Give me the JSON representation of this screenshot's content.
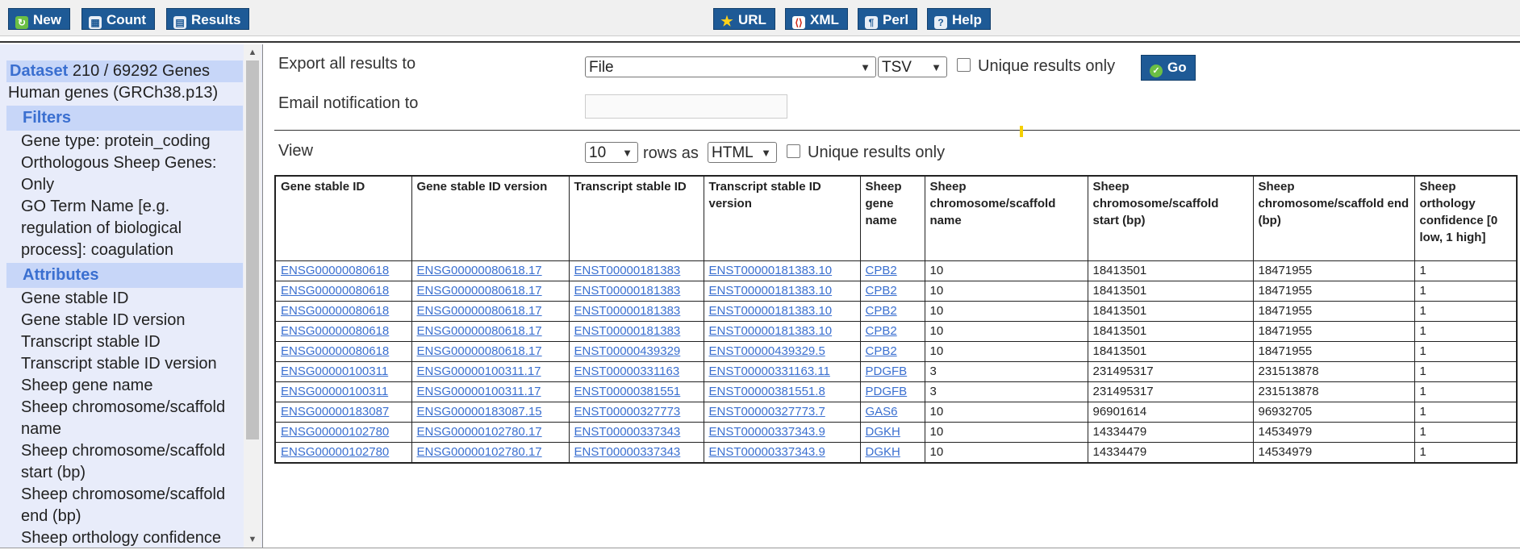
{
  "toolbar": {
    "left": [
      {
        "label": "New",
        "icon": "refresh-icon"
      },
      {
        "label": "Count",
        "icon": "calculator-icon"
      },
      {
        "label": "Results",
        "icon": "table-icon"
      }
    ],
    "right": [
      {
        "label": "URL",
        "icon": "star-icon"
      },
      {
        "label": "XML",
        "icon": "xml-icon"
      },
      {
        "label": "Perl",
        "icon": "perl-icon"
      },
      {
        "label": "Help",
        "icon": "help-icon"
      }
    ]
  },
  "sidebar": {
    "dataset_label": "Dataset",
    "dataset_count": "210 / 69292 Genes",
    "dataset_name": "Human genes (GRCh38.p13)",
    "filters_title": "Filters",
    "filters": [
      "Gene type: protein_coding",
      "Orthologous Sheep Genes: Only",
      "GO Term Name [e.g. regulation of biological process]: coagulation"
    ],
    "attributes_title": "Attributes",
    "attributes": [
      "Gene stable ID",
      "Gene stable ID version",
      "Transcript stable ID",
      "Transcript stable ID version",
      "Sheep gene name",
      "Sheep chromosome/scaffold name",
      "Sheep chromosome/scaffold start (bp)",
      "Sheep chromosome/scaffold end (bp)",
      "Sheep orthology confidence"
    ]
  },
  "export": {
    "label": "Export  all results to",
    "destination": "File",
    "format": "TSV",
    "unique_label": "Unique results only",
    "go_label": "Go"
  },
  "email": {
    "label": "Email notification to",
    "value": ""
  },
  "view": {
    "label": "View",
    "rows": "10",
    "rows_as": "rows as",
    "format": "HTML",
    "unique_label": "Unique results only"
  },
  "table": {
    "columns": [
      "Gene stable ID",
      "Gene stable ID version",
      "Transcript stable ID",
      "Transcript stable ID version",
      "Sheep gene name",
      "Sheep chromosome/scaffold name",
      "Sheep chromosome/scaffold start (bp)",
      "Sheep chromosome/scaffold end (bp)",
      "Sheep orthology confidence [0 low, 1 high]"
    ],
    "rows": [
      [
        "ENSG00000080618",
        "ENSG00000080618.17",
        "ENST00000181383",
        "ENST00000181383.10",
        "CPB2",
        "10",
        "18413501",
        "18471955",
        "1"
      ],
      [
        "ENSG00000080618",
        "ENSG00000080618.17",
        "ENST00000181383",
        "ENST00000181383.10",
        "CPB2",
        "10",
        "18413501",
        "18471955",
        "1"
      ],
      [
        "ENSG00000080618",
        "ENSG00000080618.17",
        "ENST00000181383",
        "ENST00000181383.10",
        "CPB2",
        "10",
        "18413501",
        "18471955",
        "1"
      ],
      [
        "ENSG00000080618",
        "ENSG00000080618.17",
        "ENST00000181383",
        "ENST00000181383.10",
        "CPB2",
        "10",
        "18413501",
        "18471955",
        "1"
      ],
      [
        "ENSG00000080618",
        "ENSG00000080618.17",
        "ENST00000439329",
        "ENST00000439329.5",
        "CPB2",
        "10",
        "18413501",
        "18471955",
        "1"
      ],
      [
        "ENSG00000100311",
        "ENSG00000100311.17",
        "ENST00000331163",
        "ENST00000331163.11",
        "PDGFB",
        "3",
        "231495317",
        "231513878",
        "1"
      ],
      [
        "ENSG00000100311",
        "ENSG00000100311.17",
        "ENST00000381551",
        "ENST00000381551.8",
        "PDGFB",
        "3",
        "231495317",
        "231513878",
        "1"
      ],
      [
        "ENSG00000183087",
        "ENSG00000183087.15",
        "ENST00000327773",
        "ENST00000327773.7",
        "GAS6",
        "10",
        "96901614",
        "96932705",
        "1"
      ],
      [
        "ENSG00000102780",
        "ENSG00000102780.17",
        "ENST00000337343",
        "ENST00000337343.9",
        "DGKH",
        "10",
        "14334479",
        "14534979",
        "1"
      ],
      [
        "ENSG00000102780",
        "ENSG00000102780.17",
        "ENST00000337343",
        "ENST00000337343.9",
        "DGKH",
        "10",
        "14334479",
        "14534979",
        "1"
      ]
    ]
  }
}
